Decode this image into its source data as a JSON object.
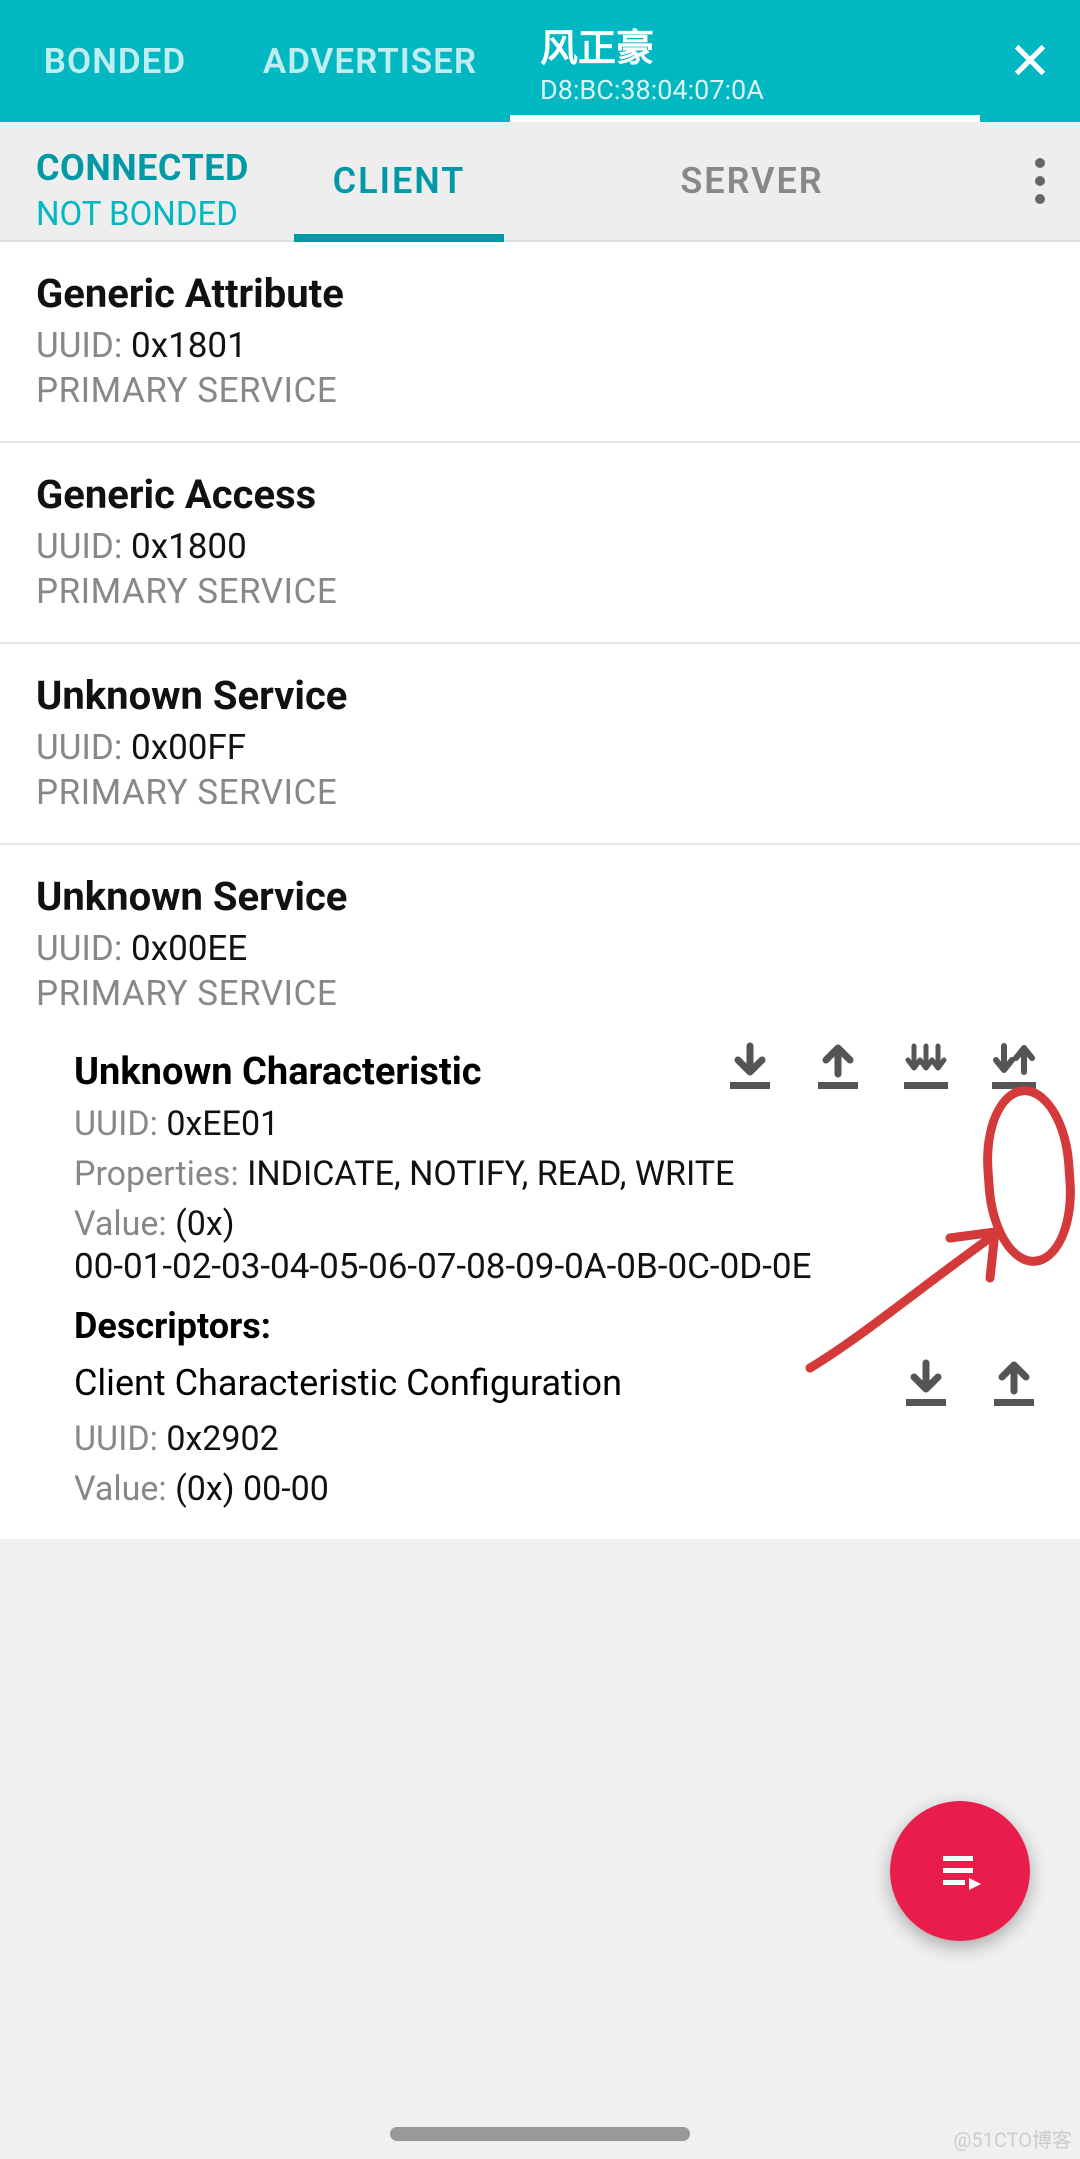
{
  "topTabs": {
    "bonded": "BONDED",
    "advertiser": "ADVERTISER",
    "device": {
      "name": "风正豪",
      "mac": "D8:BC:38:04:07:0A"
    }
  },
  "status": {
    "connected": "CONNECTED",
    "bonded": "NOT BONDED"
  },
  "modeTabs": {
    "client": "CLIENT",
    "server": "SERVER"
  },
  "labels": {
    "uuid": "UUID:",
    "properties": "Properties:",
    "value": "Value:",
    "descriptors": "Descriptors:"
  },
  "services": [
    {
      "name": "Generic Attribute",
      "uuid": "0x1801",
      "type": "PRIMARY SERVICE"
    },
    {
      "name": "Generic Access",
      "uuid": "0x1800",
      "type": "PRIMARY SERVICE"
    },
    {
      "name": "Unknown Service",
      "uuid": "0x00FF",
      "type": "PRIMARY SERVICE"
    },
    {
      "name": "Unknown Service",
      "uuid": "0x00EE",
      "type": "PRIMARY SERVICE"
    }
  ],
  "characteristic": {
    "name": "Unknown Characteristic",
    "uuid": "0xEE01",
    "properties": "INDICATE, NOTIFY, READ, WRITE",
    "valuePrefix": "(0x)",
    "valueHex": "00-01-02-03-04-05-06-07-08-09-0A-0B-0C-0D-0E",
    "descriptor": {
      "name": "Client Characteristic Configuration",
      "uuid": "0x2902",
      "valuePrefix": "(0x)",
      "valueHex": "00-00"
    }
  },
  "watermark": "@51CTO博客"
}
